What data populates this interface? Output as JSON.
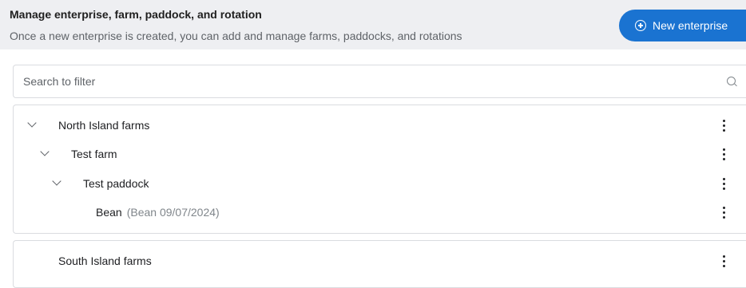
{
  "header": {
    "title": "Manage enterprise, farm, paddock, and rotation",
    "subtitle": "Once a new enterprise is created, you can add and manage farms, paddocks, and rotations",
    "new_button_label": "New enterprise",
    "new_button_icon": "plus-circle-icon",
    "button_color": "#1a73d1"
  },
  "search": {
    "placeholder": "Search to filter",
    "value": "",
    "icon": "search-icon"
  },
  "tree": {
    "enterprises": [
      {
        "name": "North Island farms",
        "expanded": true,
        "farm": {
          "name": "Test farm",
          "expanded": true,
          "paddock": {
            "name": "Test paddock",
            "expanded": true,
            "rotation": {
              "crop": "Bean",
              "detail": "(Bean 09/07/2024)"
            }
          }
        }
      },
      {
        "name": "South Island farms",
        "expanded": false
      }
    ]
  }
}
